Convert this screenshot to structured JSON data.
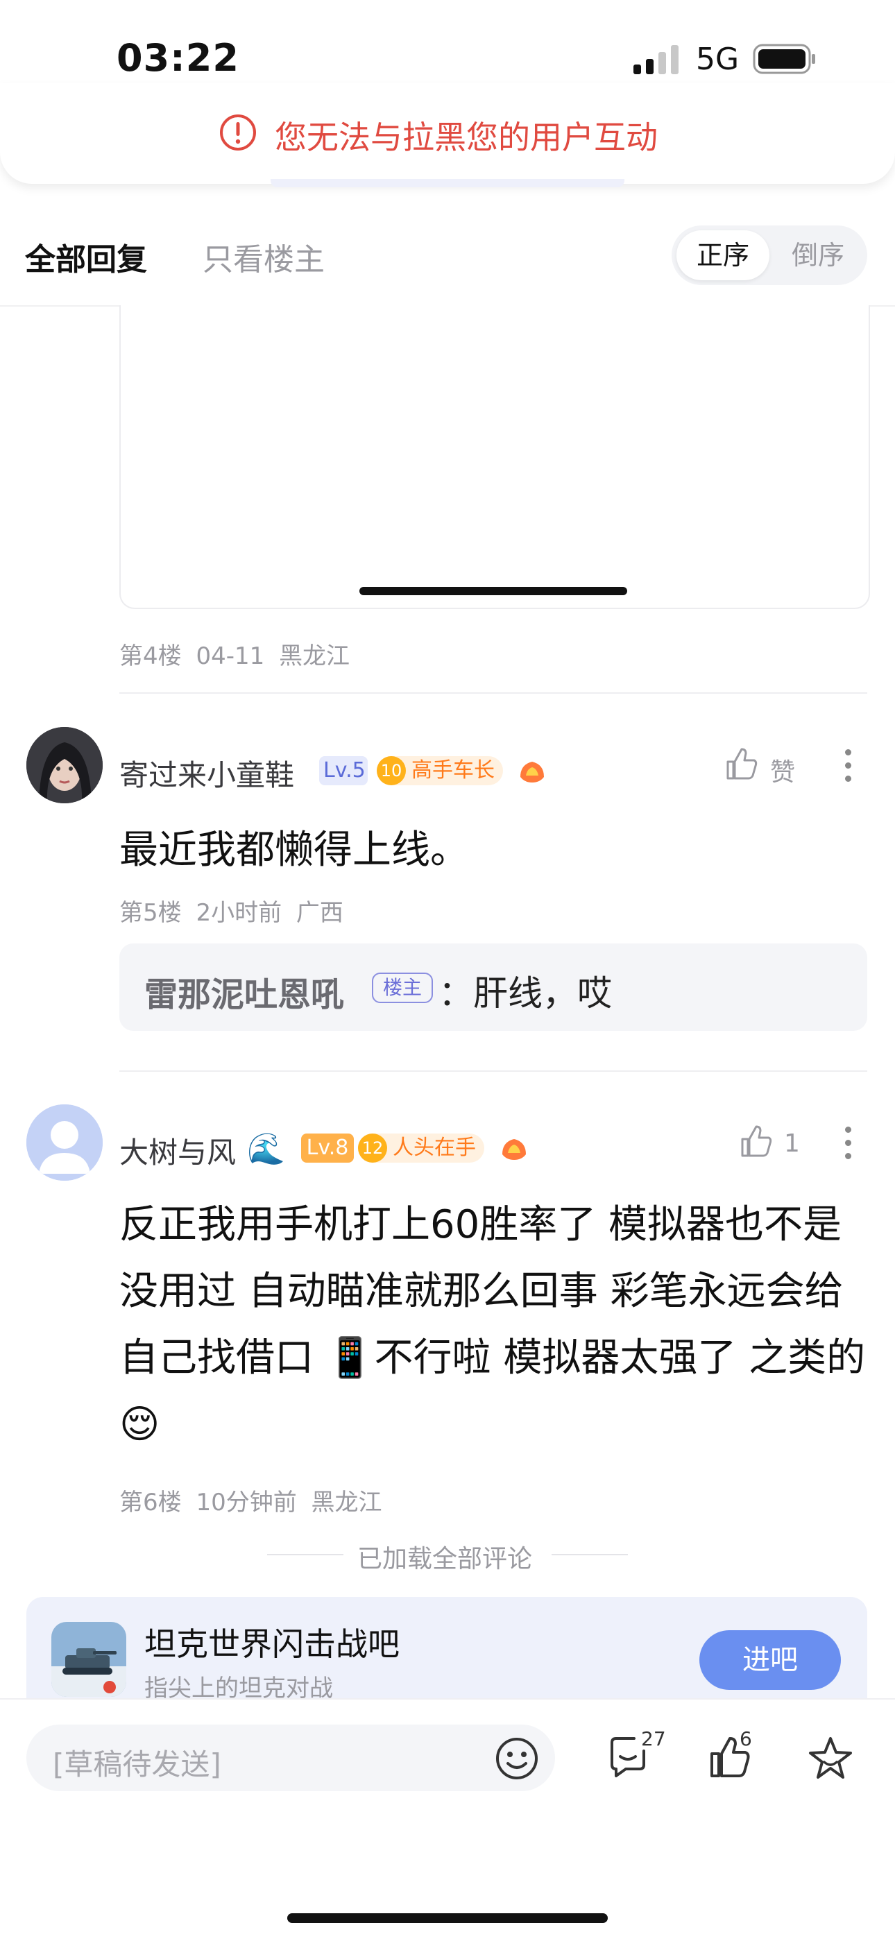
{
  "status_bar": {
    "time": "03:22",
    "network": "5G"
  },
  "toast": {
    "text": "您无法与拉黑您的用户互动",
    "icon": "alert-circle-icon",
    "color": "#e04a40"
  },
  "tabs": {
    "all_replies": "全部回复",
    "op_only": "只看楼主",
    "sort_asc": "正序",
    "sort_desc": "倒序",
    "selected_sort": "正序"
  },
  "posts": [
    {
      "floor": "第4楼",
      "time": "04-11",
      "location": "黑龙江"
    },
    {
      "username": "寄过来小童鞋",
      "level": "Lv.5",
      "badge_num": "10",
      "badge_text": "高手车长",
      "like_label": "赞",
      "body": "最近我都懒得上线。",
      "floor": "第5楼",
      "time": "2小时前",
      "location": "广西",
      "reply": {
        "name": "雷那泥吐恩吼",
        "tag": "楼主",
        "text": "：肝线，哎"
      }
    },
    {
      "username": "大树与风",
      "username_emoji": "🌊",
      "level": "Lv.8",
      "badge_num": "12",
      "badge_text": "人头在手",
      "like_count": "1",
      "body": "反正我用手机打上60胜率了 模拟器也不是没用过 自动瞄准就那么回事 彩笔永远会给自己找借口 📱不行啦 模拟器太强了 之类的😌",
      "floor": "第6楼",
      "time": "10分钟前",
      "location": "黑龙江"
    }
  ],
  "end_text": "已加载全部评论",
  "forum": {
    "name": "坦克世界闪击战吧",
    "subtitle": "指尖上的坦克对战",
    "join_label": "进吧"
  },
  "bottom_bar": {
    "draft_placeholder": "[草稿待发送]",
    "comment_count": "27",
    "like_count": "6",
    "icons": [
      "emoji-icon",
      "comment-icon",
      "thumb-up-icon",
      "star-icon"
    ]
  },
  "colors": {
    "accent": "#6a8ff0",
    "alert": "#e04a40",
    "badge_orange": "#ff7a1a"
  }
}
